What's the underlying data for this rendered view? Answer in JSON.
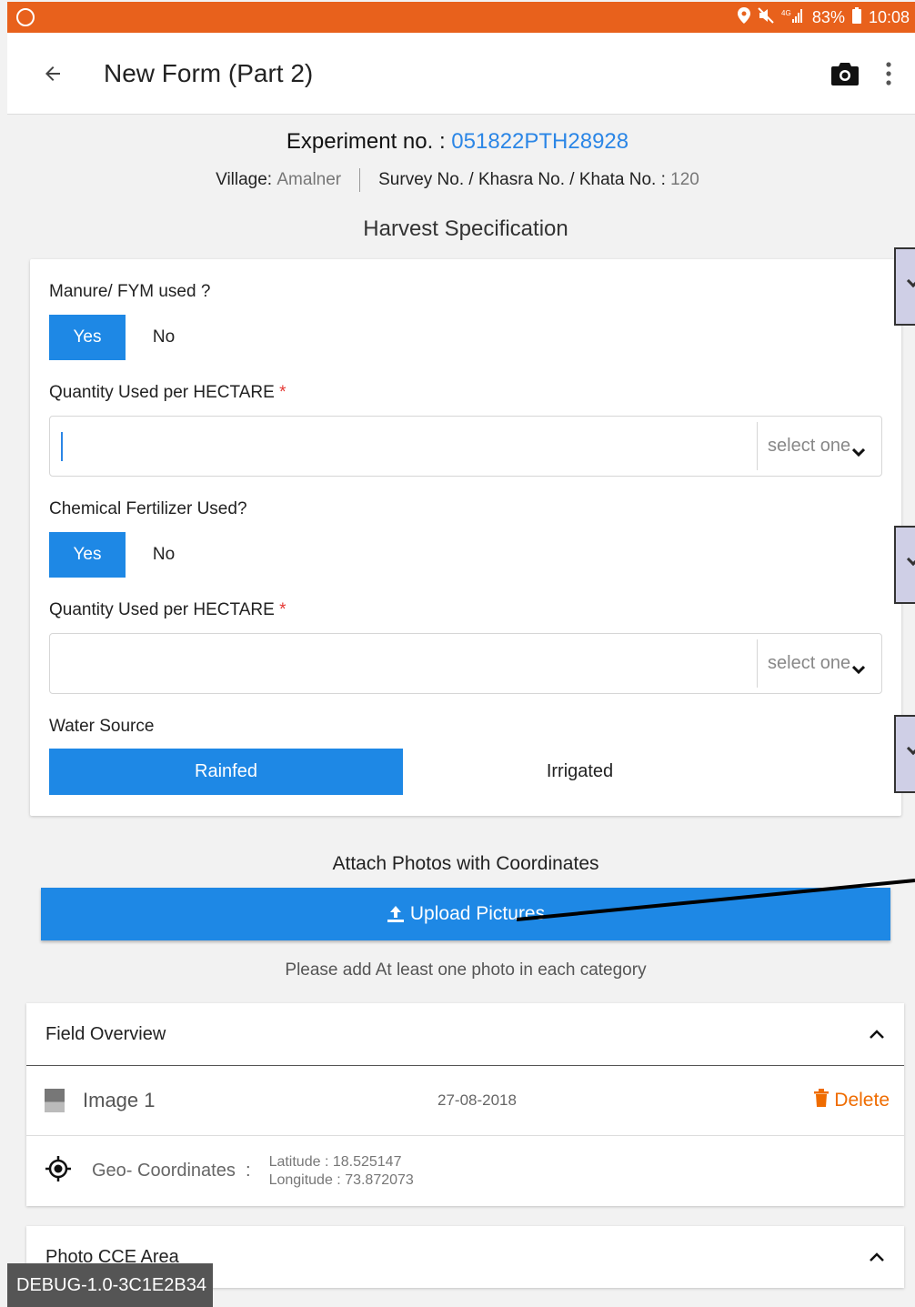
{
  "status_bar": {
    "battery": "83%",
    "time": "10:08"
  },
  "toolbar": {
    "title": "New Form (Part 2)"
  },
  "header": {
    "experiment_label": "Experiment no. :",
    "experiment_value": "051822PTH28928",
    "village_label": "Village:",
    "village_value": "Amalner",
    "survey_label": "Survey No. / Khasra No. / Khata No. :",
    "survey_value": "120",
    "section_title": "Harvest Specification"
  },
  "form": {
    "manure": {
      "label": "Manure/ FYM used ?",
      "yes": "Yes",
      "no": "No",
      "selected": "Yes"
    },
    "qty1": {
      "label": "Quantity Used per HECTARE",
      "required_mark": "*",
      "value": "",
      "unit_select": "select one"
    },
    "chemical": {
      "label": "Chemical Fertilizer Used?",
      "yes": "Yes",
      "no": "No",
      "selected": "Yes"
    },
    "qty2": {
      "label": "Quantity Used per HECTARE",
      "required_mark": "*",
      "value": "",
      "unit_select": "select one"
    },
    "water": {
      "label": "Water Source",
      "rainfed": "Rainfed",
      "irrigated": "Irrigated",
      "selected": "Rainfed"
    }
  },
  "attach": {
    "title": "Attach Photos with Coordinates",
    "upload_label": "Upload Pictures",
    "hint": "Please add At least one photo in each category"
  },
  "panels": [
    {
      "title": "Field Overview",
      "image_name": "Image 1",
      "image_date": "27-08-2018",
      "delete_label": "Delete",
      "geo_label": "Geo- Coordinates",
      "geo_sep": ":",
      "latitude": "Latitude : 18.525147",
      "longitude": "Longitude : 73.872073"
    },
    {
      "title": "Photo CCE Area"
    }
  ],
  "debug_label": "DEBUG-1.0-3C1E2B34",
  "colors": {
    "status_bar": "#e8611c",
    "primary": "#1e88e5",
    "accent_link": "#2b86e6",
    "delete": "#ef6c00",
    "required": "#e53935"
  }
}
